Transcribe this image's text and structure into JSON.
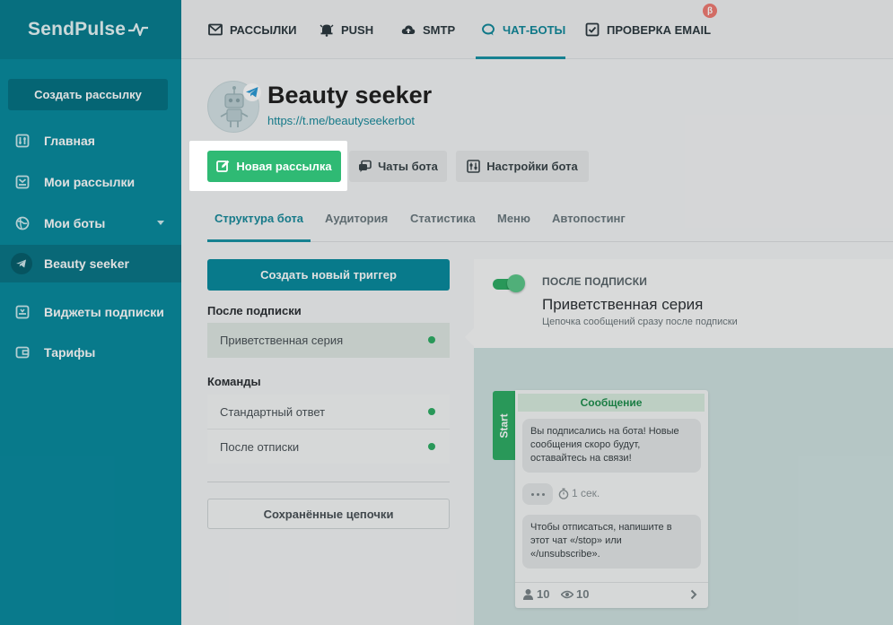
{
  "brand": {
    "name": "SendPulse"
  },
  "sidebar": {
    "create_label": "Создать рассылку",
    "items": [
      {
        "label": "Главная",
        "icon": "home-icon"
      },
      {
        "label": "Мои рассылки",
        "icon": "campaigns-icon"
      },
      {
        "label": "Мои боты",
        "icon": "bots-icon"
      },
      {
        "label": "Beauty seeker",
        "icon": "telegram-icon"
      },
      {
        "label": "Виджеты подписки",
        "icon": "widgets-icon"
      },
      {
        "label": "Тарифы",
        "icon": "wallet-icon"
      }
    ]
  },
  "topnav": {
    "items": [
      {
        "label": "РАССЫЛКИ",
        "icon": "mail-icon"
      },
      {
        "label": "PUSH",
        "icon": "bell-icon"
      },
      {
        "label": "SMTP",
        "icon": "cloud-upload-icon"
      },
      {
        "label": "ЧАТ-БОТЫ",
        "icon": "chat-icon"
      },
      {
        "label": "ПРОВЕРКА EMAIL",
        "icon": "checkbox-icon"
      }
    ],
    "beta_badge": "β"
  },
  "bot": {
    "name": "Beauty seeker",
    "link": "https://t.me/beautyseekerbot"
  },
  "actions": {
    "new_campaign": "Новая рассылка",
    "chats": "Чаты бота",
    "settings": "Настройки бота"
  },
  "subtabs": [
    "Структура бота",
    "Аудитория",
    "Статистика",
    "Меню",
    "Автопостинг"
  ],
  "left": {
    "create_trigger": "Создать новый триггер",
    "after_subscribe_title": "После подписки",
    "after_subscribe_items": [
      "Приветственная серия"
    ],
    "commands_title": "Команды",
    "commands_items": [
      "Стандартный ответ",
      "После отписки"
    ],
    "saved_chains": "Сохранённые цепочки"
  },
  "info": {
    "label": "После подписки",
    "title": "Приветственная серия",
    "desc": "Цепочка сообщений сразу после подписки"
  },
  "flow": {
    "start_label": "Start",
    "node_title": "Сообщение",
    "message1": "Вы подписались на бота! Новые сообщения скоро будут, оставайтесь на связи!",
    "delay": "1 сек.",
    "message2": "Чтобы отписаться, напишите в этот чат «/stop» или «/unsubscribe».",
    "stat_users": "10",
    "stat_views": "10"
  },
  "colors": {
    "sidebar": "#0a8b9f",
    "accent_green": "#2fba74",
    "teal_text": "#1a8b9c"
  }
}
